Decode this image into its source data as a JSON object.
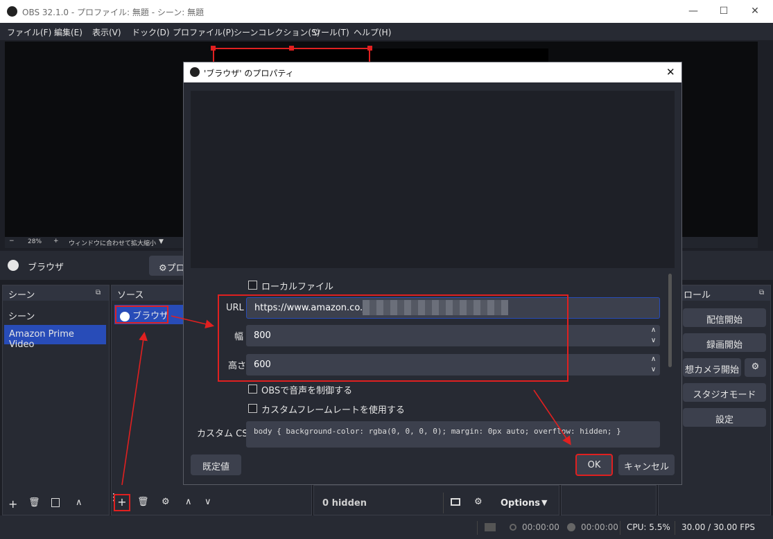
{
  "window": {
    "title": "OBS 32.1.0 - プロファイル: 無題 - シーン: 無題",
    "minimize": "—",
    "maximize": "☐",
    "close": "✕"
  },
  "menu": [
    "ファイル(F)",
    "編集(E)",
    "表示(V)",
    "ドック(D)",
    "プロファイル(P)",
    "シーンコレクション(S)",
    "ツール(T)",
    "ヘルプ(H)"
  ],
  "zoom": {
    "minus": "−",
    "value": "28%",
    "plus": "+",
    "fit_label": "ウィンドウに合わせて拡大縮小",
    "arrow": "▼"
  },
  "source_bar": {
    "name": "ブラウザ",
    "props_label": "プロ"
  },
  "scenes": {
    "title": "シーン",
    "items": [
      "シーン",
      "Amazon Prime Video"
    ]
  },
  "sources": {
    "title": "ソース",
    "items": [
      "ブラウザ"
    ]
  },
  "controls": {
    "title": "ロール",
    "buttons": [
      "配信開始",
      "録画開始",
      "想カメラ開始",
      "スタジオモード",
      "設定"
    ]
  },
  "mixer": {
    "hidden": "0 hidden",
    "options": "Options"
  },
  "dialog": {
    "title": "'ブラウザ' のプロパティ",
    "close": "✕",
    "local_file": "ローカルファイル",
    "url_label": "URL",
    "url_value": "https://www.amazon.co.jp",
    "width_label": "幅",
    "width_value": "800",
    "height_label": "高さ",
    "height_value": "600",
    "obs_audio": "OBSで音声を制御する",
    "custom_fps": "カスタムフレームレートを使用する",
    "css_label": "カスタム CSS",
    "css_value": "body { background-color: rgba(0, 0, 0, 0); margin: 0px auto; overflow: hidden; }",
    "defaults": "既定値",
    "ok": "OK",
    "cancel": "キャンセル"
  },
  "status": {
    "time1": "00:00:00",
    "time2": "00:00:00",
    "cpu": "CPU: 5.5%",
    "fps": "30.00 / 30.00 FPS"
  },
  "colors": {
    "accent": "#e02020",
    "selected": "#284cb8"
  }
}
